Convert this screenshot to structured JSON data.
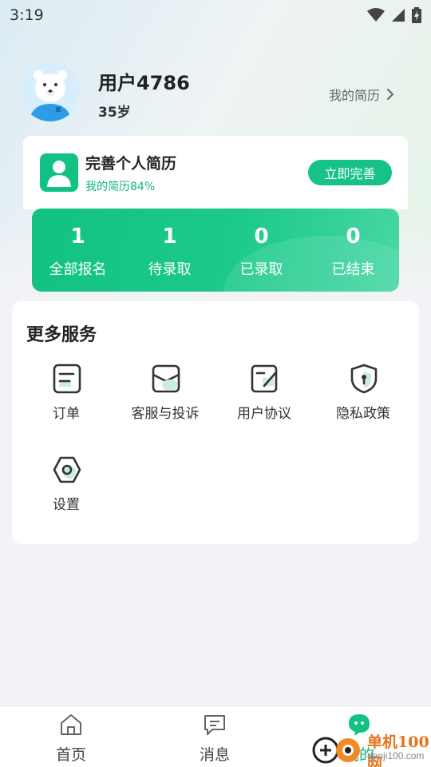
{
  "status_bar": {
    "time": "3:19"
  },
  "profile": {
    "name": "用户4786",
    "age": "35岁",
    "resume_link": "我的简历"
  },
  "complete_card": {
    "title": "完善个人简历",
    "subtitle": "我的简历84%",
    "progress_percent": 84,
    "button": "立即完善"
  },
  "stats": [
    {
      "value": "1",
      "label": "全部报名"
    },
    {
      "value": "1",
      "label": "待录取"
    },
    {
      "value": "0",
      "label": "已录取"
    },
    {
      "value": "0",
      "label": "已结束"
    }
  ],
  "services": {
    "title": "更多服务",
    "items": [
      {
        "label": "订单",
        "icon": "order-icon"
      },
      {
        "label": "客服与投诉",
        "icon": "service-mail-icon"
      },
      {
        "label": "用户协议",
        "icon": "agreement-icon"
      },
      {
        "label": "隐私政策",
        "icon": "privacy-shield-icon"
      },
      {
        "label": "设置",
        "icon": "settings-icon"
      }
    ]
  },
  "bottom_nav": [
    {
      "label": "首页",
      "icon": "home-icon"
    },
    {
      "label": "消息",
      "icon": "message-icon"
    },
    {
      "label": "我的",
      "icon": "profile-bubble-icon",
      "active": true
    }
  ],
  "watermark": {
    "text": "单机100网",
    "url": "danji100.com"
  },
  "colors": {
    "accent": "#12c283",
    "text": "#222222",
    "background": "#f3f3f7"
  }
}
